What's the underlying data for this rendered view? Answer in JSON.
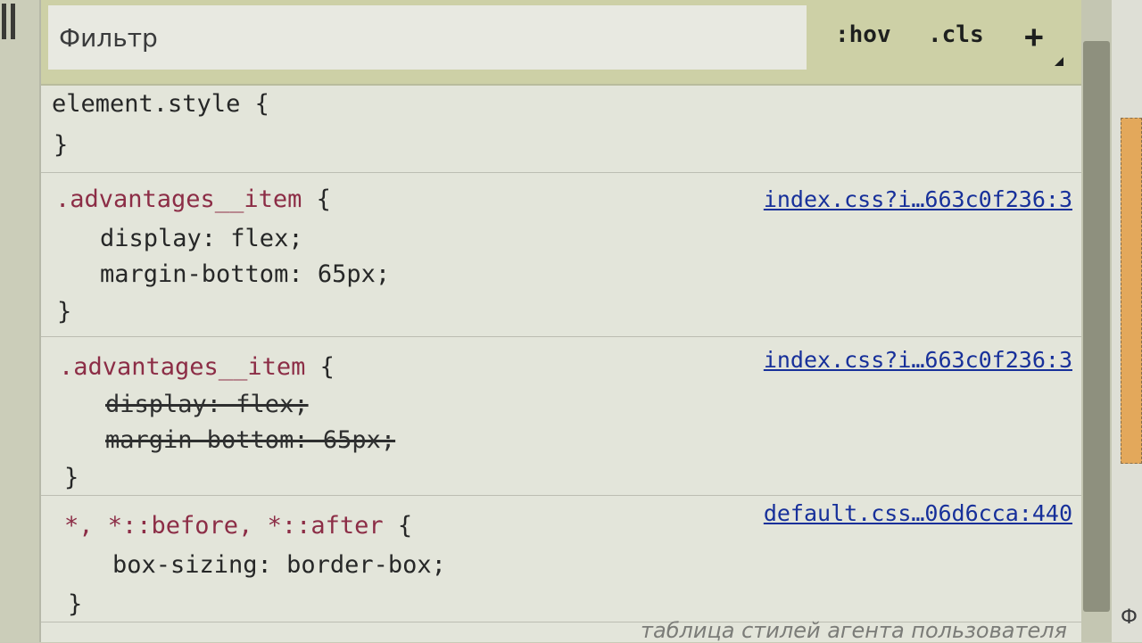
{
  "toolbar": {
    "filter_placeholder": "Фильтр",
    "hov_label": ":hov",
    "cls_label": ".cls",
    "add_label": "+"
  },
  "rules": [
    {
      "selector": "element.style",
      "open": " {",
      "close": "}",
      "declarations": []
    },
    {
      "selector": ".advantages__item",
      "open": " {",
      "close": "}",
      "source": "index.css?i…663c0f236:3",
      "declarations": [
        {
          "property": "display",
          "value": "flex",
          "text": "display: flex;",
          "overridden": false
        },
        {
          "property": "margin-bottom",
          "value": "65px",
          "text": "margin-bottom: 65px;",
          "overridden": false
        }
      ]
    },
    {
      "selector": ".advantages__item",
      "open": " {",
      "close": "}",
      "source": "index.css?i…663c0f236:3",
      "declarations": [
        {
          "property": "display",
          "value": "flex",
          "text": "display: flex;",
          "overridden": true
        },
        {
          "property": "margin-bottom",
          "value": "65px",
          "text": "margin-bottom: 65px;",
          "overridden": true
        }
      ]
    },
    {
      "selector": "*, *::before, *::after",
      "open": " {",
      "close": "}",
      "source": "default.css…06d6cca:440",
      "declarations": [
        {
          "property": "box-sizing",
          "value": "border-box",
          "text": "box-sizing: border-box;",
          "overridden": false
        }
      ]
    }
  ],
  "user_agent_label": "таблица стилей агента пользователя",
  "side_pane": {
    "letter": "Ф",
    "box_color": "#e3a85b"
  },
  "colors": {
    "selector": "#8c2d46",
    "link": "#17309a",
    "toolbar_bg": "#cdd0a6"
  }
}
